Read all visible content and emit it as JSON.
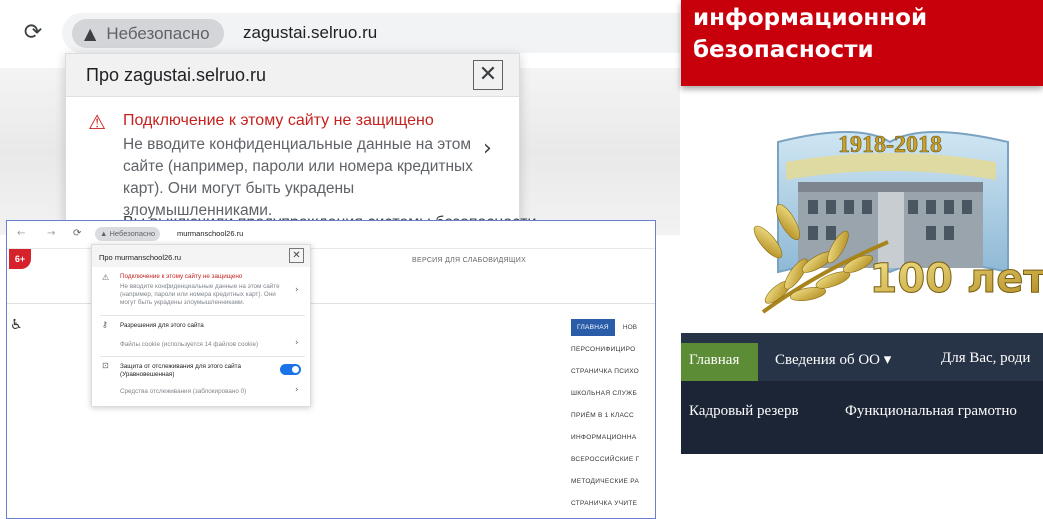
{
  "browser_large": {
    "reload_icon": "reload-icon",
    "security_chip_label": "Небезопасно",
    "url": "zagustai.selruo.ru",
    "popup": {
      "title": "Про zagustai.selruo.ru",
      "warning_title": "Подключение к этому сайту не защищено",
      "warning_body": "Не вводите конфиденциальные данные на этом сайте (например, пароли или номера кредитных карт). Они могут быть украдены злоумышленниками.",
      "cut_text": "Вы выключили предупреждения системы безопасности"
    }
  },
  "browser_small": {
    "security_chip_label": "Небезопасно",
    "url": "murmanschool26.ru",
    "age_badge": "6+",
    "version_link": "ВЕРСИЯ ДЛЯ СЛАБОВИДЯЩИХ",
    "popup": {
      "title": "Про murmanschool26.ru",
      "warning_title": "Подключение к этому сайту не защищено",
      "warning_body": "Не вводите конфиденциальные данные на этом сайте (например, пароли или номера кредитных карт). Они могут быть украдены злоумышленниками.",
      "permissions_label": "Разрешения для этого сайта",
      "cookies_label": "Файлы cookie (используется 14 файлов cookie)",
      "tracking_label": "Защита от отслеживания для этого сайта (Уравновешенная)",
      "trackers_label": "Средства отслеживания (заблокировано 0)"
    },
    "menu": {
      "main": "ГЛАВНАЯ",
      "next": "НОВ",
      "items": [
        "ПЕРСОНИФИЦИРО",
        "СТРАНИЧКА ПСИХО",
        "ШКОЛЬНАЯ СЛУЖБ",
        "ПРИЁМ В 1 КЛАСС",
        "ИНФОРМАЦИОННА",
        "ВСЕРОССИЙСКИЕ Г",
        "МЕТОДИЧЕСКИЕ РА",
        "СТРАНИЧКА УЧИТЕ"
      ]
    }
  },
  "site": {
    "banner_line1": "информационной",
    "banner_line2": "безопасности",
    "emblem_years": "1918-2018",
    "emblem_anniversary": "100 лет",
    "nav_row1": [
      "Главная",
      "Сведения об ОО ▾",
      "Для Вас, роди"
    ],
    "nav_row2": [
      "Кадровый резерв",
      "Функциональная грамотно"
    ]
  },
  "colors": {
    "banner_red": "#c8000c",
    "warning_red": "#c5221f",
    "nav_dark": "#273347",
    "nav_active_green": "#5d8c36",
    "menu_blue": "#2a5caa",
    "toggle_blue": "#1a73e8"
  }
}
